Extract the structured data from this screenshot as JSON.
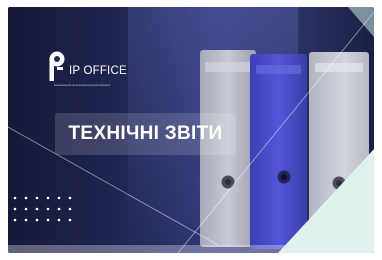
{
  "brand": {
    "name": "IP OFFICE",
    "subtitle": "Національний орган інтелектуальної власності"
  },
  "banner": {
    "title": "ТЕХНІЧНІ ЗВІТИ"
  },
  "colors": {
    "background_dark": "#1a1e44",
    "background_mid": "#313a78",
    "accent_mint": "#dff3ee",
    "binder_purple": "#4a4ed0",
    "binder_grey": "#b9bcc8",
    "text": "#ffffff"
  },
  "icons": [
    "ip-office-logo-icon",
    "dot-grid-decoration",
    "folder-binders-illustration"
  ]
}
